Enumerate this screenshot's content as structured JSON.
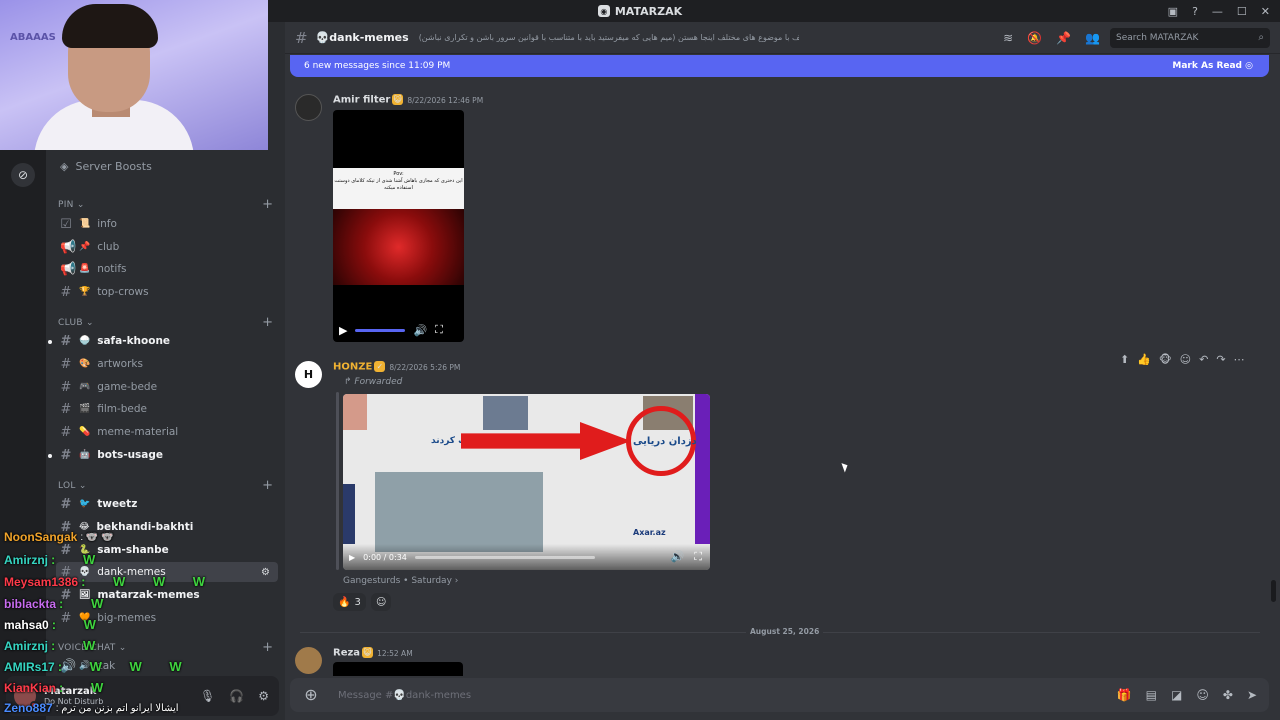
{
  "window": {
    "title": "MATARZAK",
    "controls": [
      "▣",
      "?",
      "—",
      "☐",
      "✕"
    ]
  },
  "webcam": {
    "wall_text": "ABAAAS"
  },
  "sidebar": {
    "server_boosts": "Server Boosts",
    "categories": [
      {
        "label": "PIN ⌄"
      },
      {
        "label": "CLUB ⌄"
      },
      {
        "label": "LOL ⌄"
      },
      {
        "label": "VOICE CHAT ⌄"
      }
    ],
    "channels": [
      {
        "label": "info",
        "emoji": "📜"
      },
      {
        "label": "club",
        "emoji": "📌"
      },
      {
        "label": "notifs",
        "emoji": "🚨"
      },
      {
        "label": "top-crows",
        "emoji": "🏆"
      },
      {
        "label": "safa-khoone",
        "emoji": "🍚"
      },
      {
        "label": "artworks",
        "emoji": "🎨"
      },
      {
        "label": "game-bede",
        "emoji": "🎮"
      },
      {
        "label": "film-bede",
        "emoji": "🎬"
      },
      {
        "label": "meme-material",
        "emoji": "💊"
      },
      {
        "label": "bots-usage",
        "emoji": "🤖"
      },
      {
        "label": "tweetz",
        "emoji": "🐦"
      },
      {
        "label": "bekhandi-bakhti",
        "emoji": "😂"
      },
      {
        "label": "sam-shanbe",
        "emoji": "🐍"
      },
      {
        "label": "dank-memes",
        "emoji": "💀"
      },
      {
        "label": "matarzak-memes",
        "emoji": "🖼"
      },
      {
        "label": "big-memes",
        "emoji": "🧡"
      },
      {
        "label": "zak",
        "emoji": "🔊"
      }
    ]
  },
  "twitch_chat": [
    {
      "user": "NoonSangak",
      "color": "#f0a32a",
      "text": ": 🐨 🐨"
    },
    {
      "user": "Amirznj",
      "color": "#36d6c3",
      "text": ": W"
    },
    {
      "user": "Meysam1386",
      "color": "#ff3b4a",
      "text": ": W W W"
    },
    {
      "user": "biblackta",
      "color": "#c86cf0",
      "text": ": W"
    },
    {
      "user": "mahsa0",
      "color": "#ffffff",
      "text": ": W"
    },
    {
      "user": "Amirznj",
      "color": "#36d6c3",
      "text": ": W"
    },
    {
      "user": "AMIRs17",
      "color": "#36d6c3",
      "text": ": W W W"
    },
    {
      "user": "KianKian",
      "color": "#ff3b4a",
      "text": ": W"
    },
    {
      "user": "Zeno887",
      "color": "#4b8cff",
      "text": ": ایشالا ایرانو اتم بزنن من ترم"
    }
  ],
  "user_panel": {
    "name": "Matarzak",
    "status": "Do Not Disturb"
  },
  "header": {
    "channel": "dank-memes",
    "channel_emoji": "💀",
    "topic": "میم های مختلف با موضوع های مختلف اینجا هستن (میم هایی که میفرستید باید با متناسب با قوانین سرور باشن و تکراری نباشن)",
    "search_placeholder": "Search MATARZAK"
  },
  "new_messages": {
    "text": "6 new messages since 11:09 PM",
    "mark": "Mark As Read"
  },
  "messages": [
    {
      "author": "Amir filter",
      "author_color": "#dbdee1",
      "timestamp": "8/22/2026 12:46 PM",
      "video_caption": "Pov:\nاین دختری که مجازی باهاش آشنا شدی از تیکه کلامای دوستت استفاده میکنه"
    },
    {
      "author": "HONZE",
      "author_color": "#f0b232",
      "timestamp": "8/22/2026 5:26 PM",
      "forwarded": "Forwarded",
      "video_time": "0:00 / 0:34",
      "headline": "دزدان دریایی",
      "side_text": "را تصرف کردند",
      "source_site": "Axar.az",
      "source_footer": "Gangesturds • Saturday ›",
      "reactions": [
        {
          "emoji": "🔥",
          "count": "3"
        },
        {
          "emoji": "☺",
          "count": ""
        }
      ]
    },
    {
      "author": "Reza",
      "author_color": "#dbdee1",
      "timestamp": "12:52 AM"
    }
  ],
  "date_divider": "August 25, 2026",
  "composer": {
    "placeholder": "Message #💀dank-memes"
  }
}
